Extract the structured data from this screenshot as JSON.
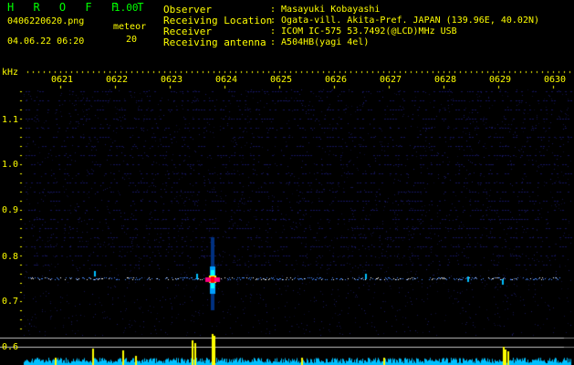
{
  "header": {
    "app_title": "H R O F F T",
    "app_version": "1.00",
    "filename": "0406220620.png",
    "datetime": "04.06.22 06:20",
    "meteor_label": "meteor",
    "meteor_count": "20"
  },
  "info": [
    {
      "key": "Observer",
      "value": ": Masayuki Kobayashi"
    },
    {
      "key": "Receiving Location",
      "value": ": Ogata-vill. Akita-Pref. JAPAN (139.96E, 40.02N)"
    },
    {
      "key": "Receiver",
      "value": ": ICOM IC-575 53.7492(@LCD)MHz USB"
    },
    {
      "key": "Receiving antenna",
      "value": ": A504HB(yagi 4el)"
    }
  ],
  "spectrogram": {
    "y_unit": "kHz",
    "time_labels": [
      "0621",
      "0622",
      "0623",
      "0624",
      "0625",
      "0626",
      "0627",
      "0628",
      "0629",
      "0630"
    ],
    "freq_labels": [
      "1.1",
      "1.0",
      "0.9",
      "0.8",
      "0.7",
      "0.6"
    ],
    "colors": {
      "text_green": "#00ff00",
      "text_yellow": "#ffff00",
      "noise_blue": "#1a1a80",
      "signal_line": "#4488ff",
      "meteor_echo": "#ff0080",
      "meteor_core": "#00ffff",
      "bar_yellow": "#ffff00",
      "bar_cyan": "#00c0ff",
      "threshold_line": "#ffffff"
    }
  }
}
